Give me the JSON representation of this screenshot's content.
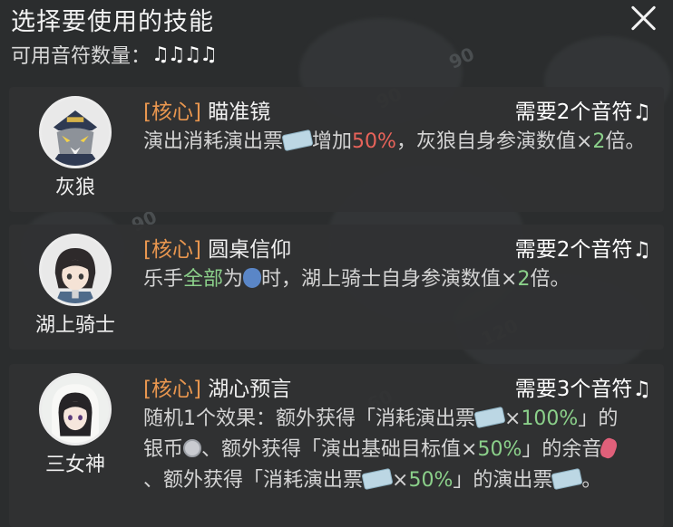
{
  "header": {
    "title": "选择要使用的技能",
    "count_label": "可用音符数量：",
    "note_glyph": "♫",
    "available_notes": 4
  },
  "skills": [
    {
      "character": "灰狼",
      "tag": "[核心]",
      "name": "瞄准镜",
      "cost": "需要2个音符",
      "desc": [
        "演出消耗演出票",
        "增加",
        "50%",
        "，灰狼自身参演数值×",
        "2",
        "倍。"
      ]
    },
    {
      "character": "湖上骑士",
      "tag": "[核心]",
      "name": "圆桌信仰",
      "cost": "需要2个音符",
      "desc": [
        "乐手",
        "全部",
        "为",
        "时，湖上骑士自身参演数值×",
        "2",
        "倍。"
      ]
    },
    {
      "character": "三女神",
      "tag": "[核心]",
      "name": "湖心预言",
      "cost": "需要3个音符",
      "desc": [
        "随机1个效果：额外获得「消耗演出票",
        "×",
        "100%",
        "」的银币",
        "、额外获得「演出基础目标值×",
        "50%",
        "」的余音",
        "、额外获得「消耗演出票",
        "×",
        "50%",
        "」的演出票",
        "。"
      ]
    }
  ],
  "colors": {
    "tag": "#e8964f",
    "highlight_red": "#e8635a",
    "highlight_green": "#8bd08a"
  },
  "icons": [
    "close-icon",
    "music-note-icon",
    "ticket-icon",
    "silver-coin-icon",
    "knight-mask-icon",
    "echo-gem-icon"
  ]
}
